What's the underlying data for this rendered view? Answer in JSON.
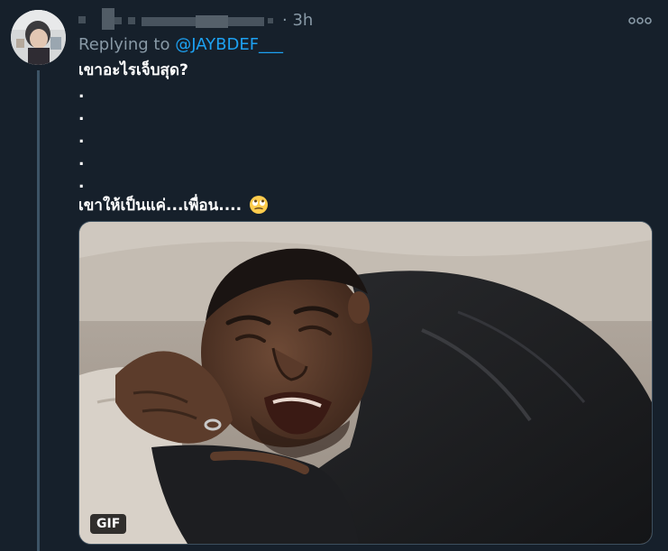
{
  "tweet": {
    "time": "· 3h",
    "replying_prefix": "Replying to ",
    "replying_handle": "@JAYBDEF___",
    "lines": [
      "เขาอะไรเจ็บสุด?",
      ".",
      ".",
      ".",
      ".",
      ".",
      "เขาให้เป็นแค่...เพื่อน...."
    ],
    "emoji_icon": "rolling-eyes-face",
    "media_badge": "GIF"
  },
  "colors": {
    "background": "#16202b",
    "mention": "#1da1f2",
    "secondary_text": "#8899a6",
    "thread_line": "#3d5466"
  }
}
